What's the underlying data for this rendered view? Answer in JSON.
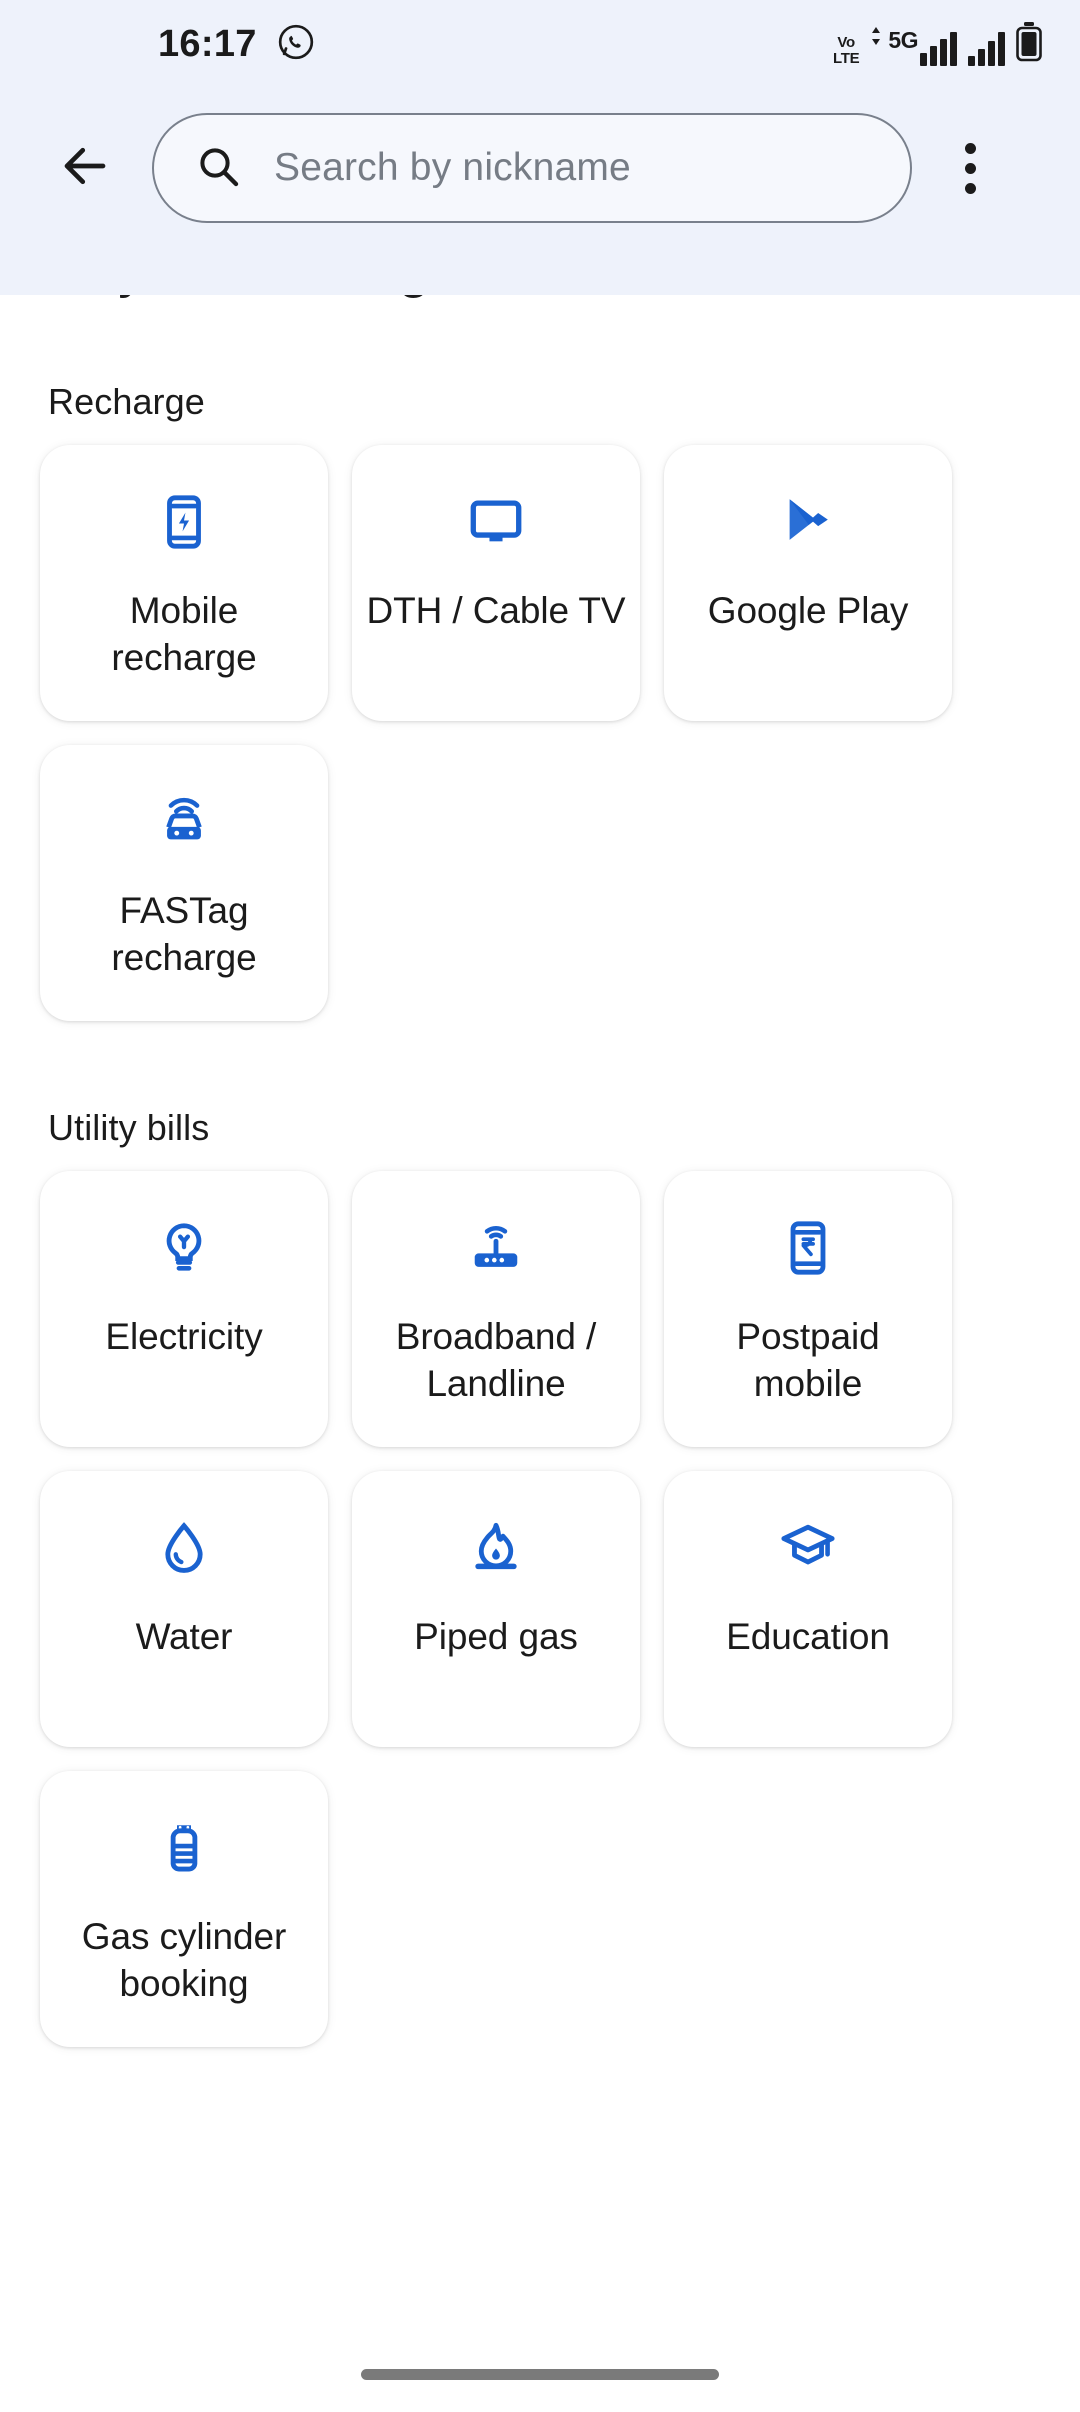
{
  "status_bar": {
    "time": "16:17",
    "icons": [
      "whatsapp-icon",
      "volte-icon",
      "5g-icon",
      "signal-bars-icon",
      "signal-bars-2-icon",
      "battery-icon"
    ],
    "volte_top": "Vo",
    "volte_bottom": "LTE",
    "network_label": "5G"
  },
  "app_bar": {
    "back_icon": "back-arrow-icon",
    "search_icon": "search-icon",
    "search_value": "",
    "search_placeholder": "Search by nickname",
    "overflow_icon": "overflow-menu-icon"
  },
  "page": {
    "title": "Payment categories"
  },
  "colors": {
    "header_bg": "#eef2fb",
    "icon_blue": "#1a62d0",
    "text_primary": "#1b1b1b",
    "text_secondary": "#767c85",
    "card_bg": "#ffffff"
  },
  "sections": [
    {
      "title": "Recharge",
      "items": [
        {
          "label": "Mobile recharge",
          "icon": "mobile-recharge-icon"
        },
        {
          "label": "DTH / Cable TV",
          "icon": "tv-icon"
        },
        {
          "label": "Google Play",
          "icon": "google-play-icon"
        },
        {
          "label": "FASTag recharge",
          "icon": "fastag-car-icon"
        }
      ]
    },
    {
      "title": "Utility bills",
      "items": [
        {
          "label": "Electricity",
          "icon": "lightbulb-icon"
        },
        {
          "label": "Broadband / Landline",
          "icon": "router-icon"
        },
        {
          "label": "Postpaid mobile",
          "icon": "phone-rupee-icon"
        },
        {
          "label": "Water",
          "icon": "water-drop-icon"
        },
        {
          "label": "Piped gas",
          "icon": "flame-icon"
        },
        {
          "label": "Education",
          "icon": "graduation-cap-icon"
        },
        {
          "label": "Gas cylinder booking",
          "icon": "gas-cylinder-icon"
        }
      ]
    }
  ],
  "navigation": {
    "home_indicator": "home-indicator"
  }
}
